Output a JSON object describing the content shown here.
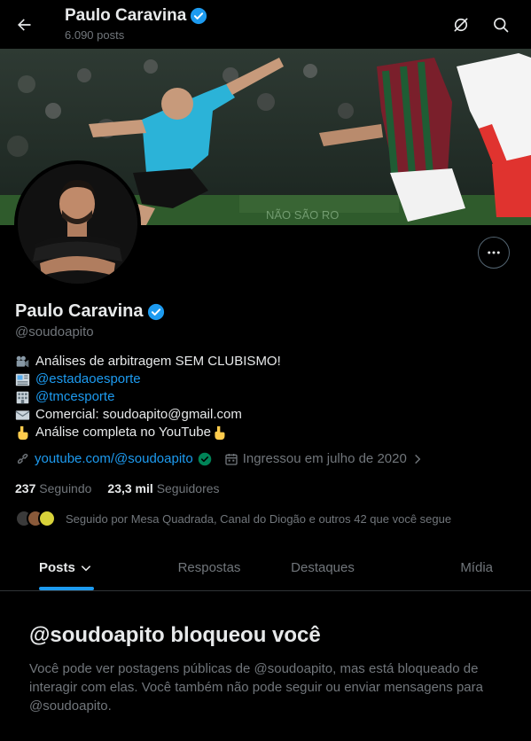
{
  "header": {
    "title": "Paulo Caravina",
    "post_count": "6.090 posts"
  },
  "profile": {
    "name": "Paulo Caravina",
    "handle": "@soudoapito",
    "bio": [
      {
        "icon": "movie-camera-emoji",
        "text": "Análises de arbitragem SEM CLUBISMO!",
        "is_link": false
      },
      {
        "icon": "newspaper-emoji",
        "text": "@estadaoesporte",
        "is_link": true
      },
      {
        "icon": "building-emoji",
        "text": "@tmcesporte",
        "is_link": true
      },
      {
        "icon": "envelope-emoji",
        "text": "Comercial: soudoapito@gmail.com",
        "is_link": false
      },
      {
        "icon": "pointing-down-emoji",
        "text": "Análise completa no YouTube",
        "is_link": false,
        "suffix_icon": "pointing-down-emoji"
      }
    ],
    "website": "youtube.com/@soudoapito",
    "joined": "Ingressou em julho de 2020",
    "following_count": "237",
    "following_label": "Seguindo",
    "followers_count": "23,3 mil",
    "followers_label": "Seguidores",
    "followed_by": "Seguido por Mesa Quadrada, Canal do Diogão e outros 42 que você segue"
  },
  "tabs": [
    {
      "label": "Posts",
      "active": true
    },
    {
      "label": "Respostas",
      "active": false
    },
    {
      "label": "Destaques",
      "active": false
    },
    {
      "label": "Mídia",
      "active": false
    }
  ],
  "blocked": {
    "title": "@soudoapito bloqueou você",
    "text": "Você pode ver postagens públicas de @soudoapito, mas está bloqueado de interagir com elas. Você também não pode seguir ou enviar mensagens para @soudoapito."
  },
  "colors": {
    "accent": "#1d9bf0",
    "verified": "#1d9bf0",
    "muted": "#71767b",
    "background": "#000000"
  }
}
